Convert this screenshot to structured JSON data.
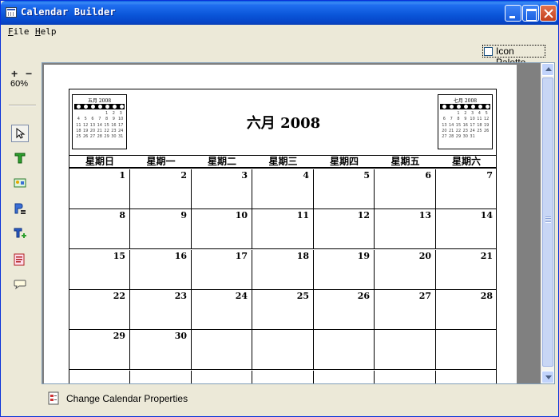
{
  "window": {
    "title": "Calendar Builder"
  },
  "menu": {
    "file": "File",
    "file_key": "F",
    "file_rest": "ile",
    "help": "Help",
    "help_key": "H",
    "help_rest": "elp"
  },
  "palette": {
    "label": "Icon Palette",
    "checked": false
  },
  "zoom": {
    "plus": "+",
    "minus": "−",
    "level": "60%"
  },
  "tools": [
    "select-tool",
    "text-tool",
    "image-tool",
    "field-tool",
    "add-text-tool",
    "note-tool",
    "comment-tool"
  ],
  "calendar": {
    "title": "六月 2008",
    "prev_mini_title": "五月 2008",
    "next_mini_title": "七月 2008",
    "prev_mini_days": [
      "",
      "",
      "",
      "",
      "1",
      "2",
      "3",
      "4",
      "5",
      "6",
      "7",
      "8",
      "9",
      "10",
      "11",
      "12",
      "13",
      "14",
      "15",
      "16",
      "17",
      "18",
      "19",
      "20",
      "21",
      "22",
      "23",
      "24",
      "25",
      "26",
      "27",
      "28",
      "29",
      "30",
      "31"
    ],
    "next_mini_days": [
      "",
      "",
      "1",
      "2",
      "3",
      "4",
      "5",
      "6",
      "7",
      "8",
      "9",
      "10",
      "11",
      "12",
      "13",
      "14",
      "15",
      "16",
      "17",
      "18",
      "19",
      "20",
      "21",
      "22",
      "23",
      "24",
      "25",
      "26",
      "27",
      "28",
      "29",
      "30",
      "31"
    ],
    "weekdays": [
      "星期日",
      "星期一",
      "星期二",
      "星期三",
      "星期四",
      "星期五",
      "星期六"
    ],
    "weeks": [
      [
        "1",
        "2",
        "3",
        "4",
        "5",
        "6",
        "7"
      ],
      [
        "8",
        "9",
        "10",
        "11",
        "12",
        "13",
        "14"
      ],
      [
        "15",
        "16",
        "17",
        "18",
        "19",
        "20",
        "21"
      ],
      [
        "22",
        "23",
        "24",
        "25",
        "26",
        "27",
        "28"
      ],
      [
        "29",
        "30",
        "",
        "",
        "",
        "",
        ""
      ],
      [
        "",
        "",
        "",
        "",
        "",
        "",
        ""
      ]
    ]
  },
  "bottom": {
    "properties_label": "Change Calendar Properties"
  }
}
